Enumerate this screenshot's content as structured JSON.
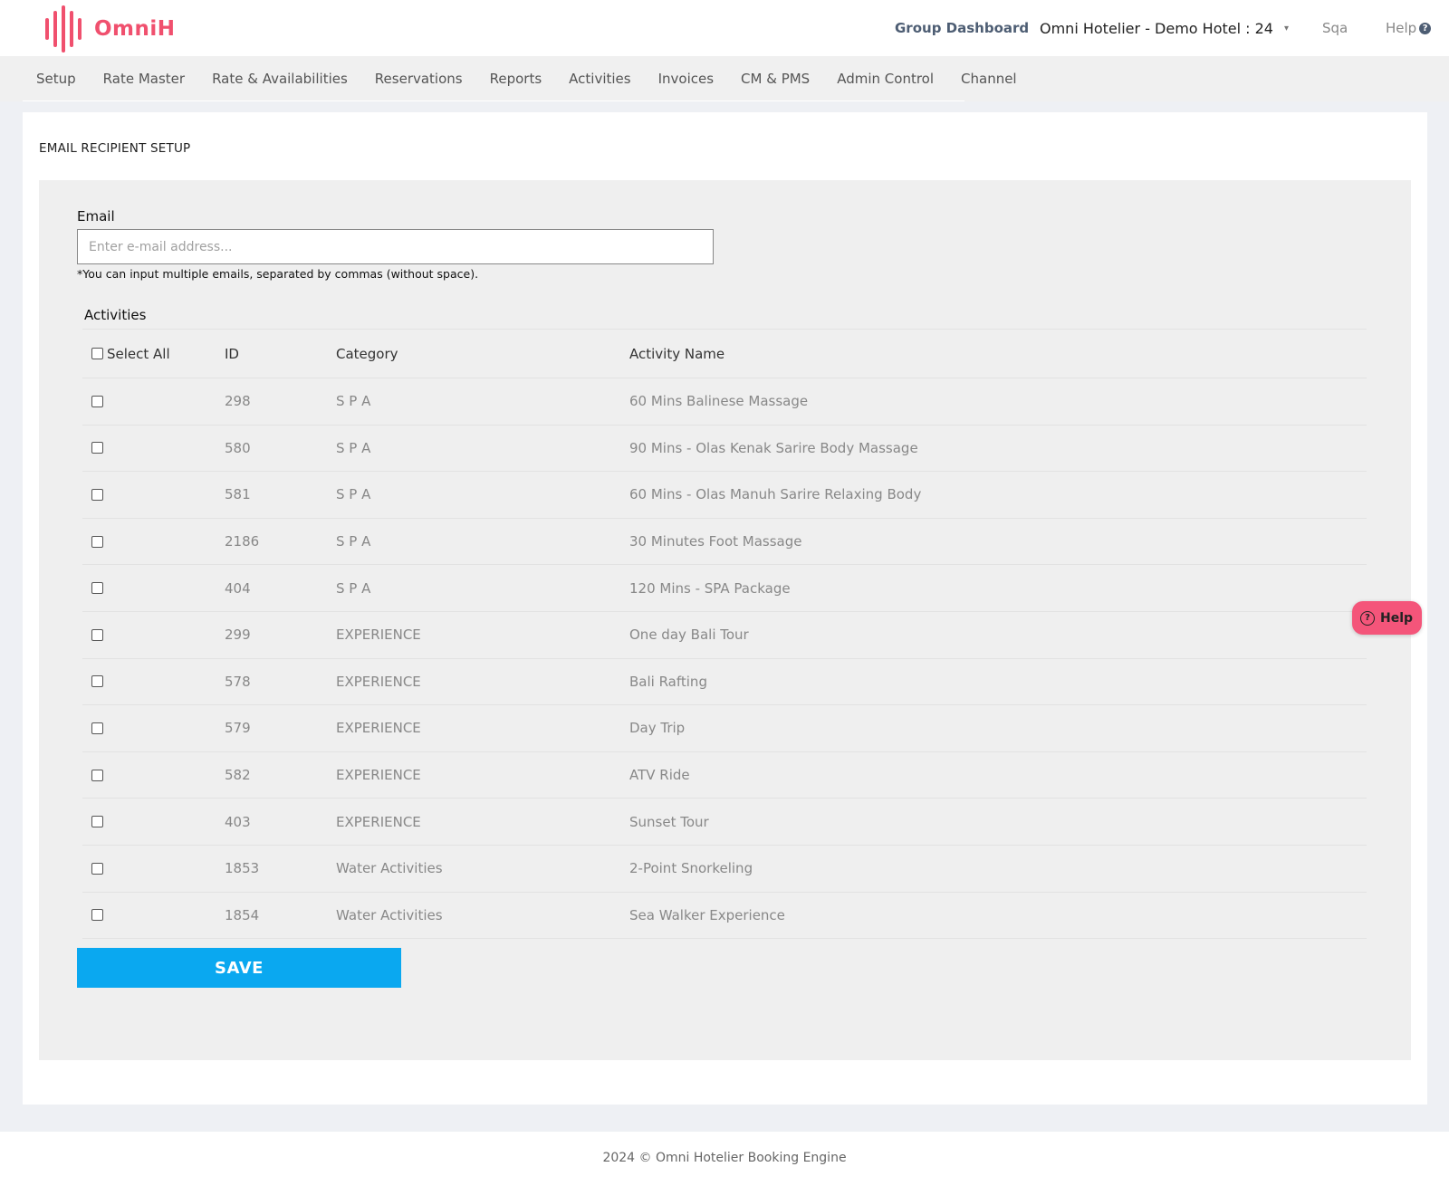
{
  "brand": {
    "name": "OmniH",
    "color": "#f0506e"
  },
  "header": {
    "group_dashboard": "Group Dashboard",
    "hotel": "Omni Hotelier - Demo Hotel : 24",
    "caret": "▾",
    "user": "Sqa",
    "help": "Help",
    "help_icon": "?"
  },
  "nav": {
    "items": [
      {
        "label": "Setup"
      },
      {
        "label": "Rate Master"
      },
      {
        "label": "Rate & Availabilities"
      },
      {
        "label": "Reservations"
      },
      {
        "label": "Reports"
      },
      {
        "label": "Activities"
      },
      {
        "label": "Invoices"
      },
      {
        "label": "CM & PMS"
      },
      {
        "label": "Admin Control"
      },
      {
        "label": "Channel"
      }
    ]
  },
  "page": {
    "title": "EMAIL RECIPIENT SETUP",
    "email_label": "Email",
    "email_placeholder": "Enter e-mail address...",
    "email_value": "",
    "email_note": "*You can input multiple emails, separated by commas (without space).",
    "activities_title": "Activities",
    "save_label": "SAVE"
  },
  "table": {
    "headers": {
      "select_all": "Select All",
      "id": "ID",
      "category": "Category",
      "name": "Activity Name"
    },
    "rows": [
      {
        "id": "298",
        "category": "S P A",
        "name": "60 Mins Balinese Massage",
        "checked": false
      },
      {
        "id": "580",
        "category": "S P A",
        "name": "90 Mins - Olas Kenak Sarire Body Massage",
        "checked": false
      },
      {
        "id": "581",
        "category": "S P A",
        "name": "60 Mins - Olas Manuh Sarire Relaxing Body",
        "checked": false
      },
      {
        "id": "2186",
        "category": "S P A",
        "name": "30 Minutes Foot Massage",
        "checked": false
      },
      {
        "id": "404",
        "category": "S P A",
        "name": "120 Mins - SPA Package",
        "checked": false
      },
      {
        "id": "299",
        "category": "EXPERIENCE",
        "name": "One day Bali Tour",
        "checked": false
      },
      {
        "id": "578",
        "category": "EXPERIENCE",
        "name": "Bali Rafting",
        "checked": false
      },
      {
        "id": "579",
        "category": "EXPERIENCE",
        "name": "Day Trip",
        "checked": false
      },
      {
        "id": "582",
        "category": "EXPERIENCE",
        "name": "ATV Ride",
        "checked": false
      },
      {
        "id": "403",
        "category": "EXPERIENCE",
        "name": "Sunset Tour",
        "checked": false
      },
      {
        "id": "1853",
        "category": "Water Activities",
        "name": "2-Point Snorkeling",
        "checked": false
      },
      {
        "id": "1854",
        "category": "Water Activities",
        "name": "Sea Walker Experience",
        "checked": false
      }
    ]
  },
  "floating_help": {
    "label": "Help",
    "icon": "?"
  },
  "footer": {
    "text": "2024 © Omni Hotelier Booking Engine"
  },
  "colors": {
    "save": "#0aa8f0",
    "help_button": "#f4557a",
    "panel": "#efefef"
  }
}
